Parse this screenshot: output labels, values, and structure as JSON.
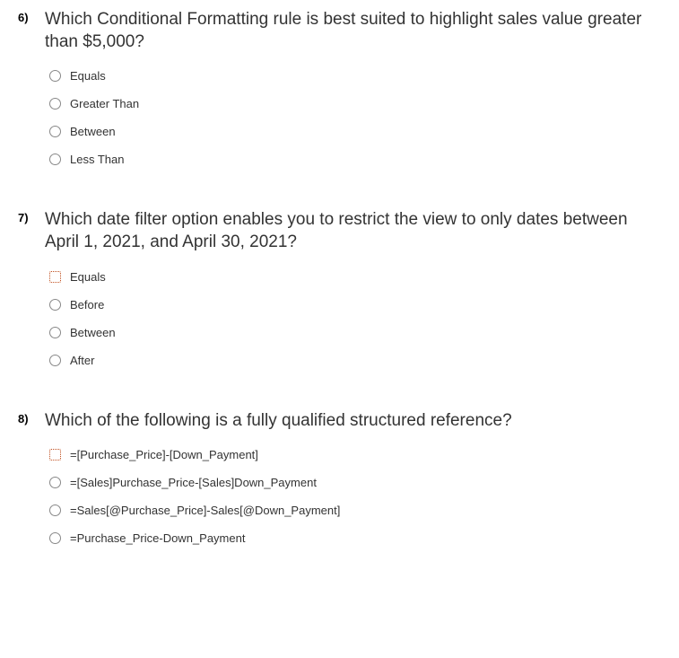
{
  "questions": [
    {
      "number": "6)",
      "text": "Which Conditional Formatting rule is best suited to highlight sales value greater than $5,000?",
      "options": [
        {
          "label": "Equals",
          "highlighted": false
        },
        {
          "label": "Greater Than",
          "highlighted": false
        },
        {
          "label": "Between",
          "highlighted": false
        },
        {
          "label": "Less Than",
          "highlighted": false
        }
      ]
    },
    {
      "number": "7)",
      "text": "Which date filter option enables you to restrict the view to only dates between April 1, 2021, and April 30, 2021?",
      "options": [
        {
          "label": "Equals",
          "highlighted": true
        },
        {
          "label": "Before",
          "highlighted": false
        },
        {
          "label": "Between",
          "highlighted": false
        },
        {
          "label": "After",
          "highlighted": false
        }
      ]
    },
    {
      "number": "8)",
      "text": "Which of the following is a fully qualified structured reference?",
      "options": [
        {
          "label": "=[Purchase_Price]-[Down_Payment]",
          "highlighted": true
        },
        {
          "label": "=[Sales]Purchase_Price-[Sales]Down_Payment",
          "highlighted": false
        },
        {
          "label": "=Sales[@Purchase_Price]-Sales[@Down_Payment]",
          "highlighted": false
        },
        {
          "label": "=Purchase_Price-Down_Payment",
          "highlighted": false
        }
      ]
    }
  ]
}
